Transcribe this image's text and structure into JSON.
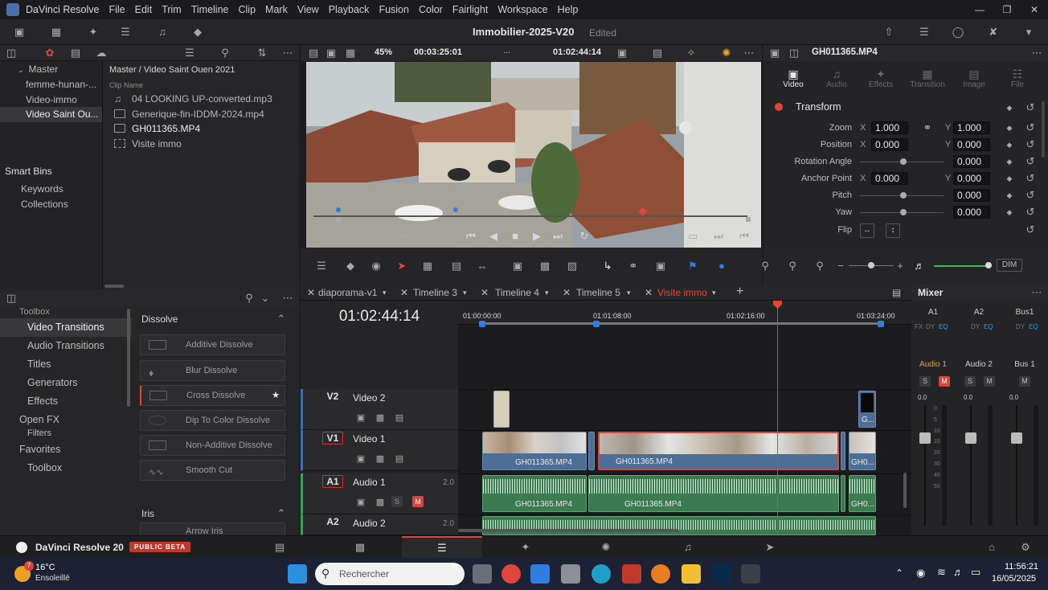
{
  "app": {
    "title": "DaVinci Resolve",
    "menu": [
      "File",
      "Edit",
      "Trim",
      "Timeline",
      "Clip",
      "Mark",
      "View",
      "Playback",
      "Fusion",
      "Color",
      "Fairlight",
      "Workspace",
      "Help"
    ],
    "project_title": "Immobilier-2025-V20",
    "project_status": "Edited"
  },
  "mediapool": {
    "breadcrumb": "Master / Video Saint Ouen 2021",
    "column_header": "Clip Name",
    "bins_root": "Master",
    "bins": [
      "femme-hunan-...",
      "Video-immo",
      "Video Saint Ou..."
    ],
    "smart_bins": "Smart Bins",
    "smart_items": [
      "Keywords",
      "Collections"
    ],
    "clips": [
      "04 LOOKING UP-converted.mp3",
      "Generique-fin-IDDM-2024.mp4",
      "GH011365.MP4",
      "Visite immo"
    ]
  },
  "viewer": {
    "zoom": "45%",
    "duration": "00:03:25:01",
    "more": "...",
    "timecode": "01:02:44:14"
  },
  "inspector": {
    "clip_name": "GH011365.MP4",
    "tabs": [
      "Video",
      "Audio",
      "Effects",
      "Transition",
      "Image",
      "File"
    ],
    "section": "Transform",
    "rows": [
      {
        "label": "Zoom",
        "x_axis": "X",
        "x": "1.000",
        "y_axis": "Y",
        "y": "1.000"
      },
      {
        "label": "Position",
        "x_axis": "X",
        "x": "0.000",
        "y_axis": "Y",
        "y": "0.000"
      },
      {
        "label": "Rotation Angle",
        "x_axis": "",
        "x": "",
        "y_axis": "",
        "y": "0.000"
      },
      {
        "label": "Anchor Point",
        "x_axis": "X",
        "x": "0.000",
        "y_axis": "Y",
        "y": "0.000"
      },
      {
        "label": "Pitch",
        "x_axis": "",
        "x": "",
        "y_axis": "",
        "y": "0.000"
      },
      {
        "label": "Yaw",
        "x_axis": "",
        "x": "",
        "y_axis": "",
        "y": "0.000"
      },
      {
        "label": "Flip",
        "x_axis": "",
        "x": "",
        "y_axis": "",
        "y": ""
      }
    ]
  },
  "effects": {
    "toolbox_label": "Toolbox",
    "categories": [
      "Video Transitions",
      "Audio Transitions",
      "Titles",
      "Generators",
      "Effects",
      "Open FX",
      "Filters"
    ],
    "favorites": "Favorites",
    "favorites_items": [
      "Toolbox"
    ],
    "group": "Dissolve",
    "items": [
      "Additive Dissolve",
      "Blur Dissolve",
      "Cross Dissolve",
      "Dip To Color Dissolve",
      "Non-Additive Dissolve",
      "Smooth Cut"
    ],
    "group2": "Iris",
    "group2_item": "Arrow Iris"
  },
  "timeline": {
    "tabs": [
      "diaporama-v1",
      "Timeline 3",
      "Timeline 4",
      "Timeline 5",
      "Visite immo"
    ],
    "timecode": "01:02:44:14",
    "ruler": [
      "01:00:00:00",
      "01:01:08:00",
      "01:02:16:00",
      "01:03:24:00"
    ],
    "tracks": [
      {
        "id": "V2",
        "name": "Video 2",
        "level": ""
      },
      {
        "id": "V1",
        "name": "Video 1",
        "level": ""
      },
      {
        "id": "A1",
        "name": "Audio 1",
        "level": "2.0"
      },
      {
        "id": "A2",
        "name": "Audio 2",
        "level": "2.0"
      }
    ],
    "clip_name": "GH011365.MP4",
    "clip_short": "GH0...",
    "v2_short": "G..."
  },
  "mixer": {
    "title": "Mixer",
    "channels": [
      "A1",
      "A2",
      "Bus1"
    ],
    "channel_names": [
      "Audio 1",
      "Audio 2",
      "Bus 1"
    ],
    "level_db": "0.0",
    "scale": [
      "0",
      "5",
      "10",
      "15",
      "20",
      "30",
      "40",
      "50"
    ],
    "dim": "DIM"
  },
  "pagebar": {
    "app_label": "DaVinci Resolve 20",
    "badge": "PUBLIC BETA"
  },
  "taskbar": {
    "weather_temp": "16°C",
    "weather_desc": "Ensoleillé",
    "weather_badge": "7",
    "search_placeholder": "Rechercher",
    "time": "11:56:21",
    "date": "16/05/2025"
  },
  "colors": {
    "accent": "#e0463b",
    "video_clip": "#4e6f95",
    "audio_clip": "#3c7a52",
    "playhead": "#e0463b",
    "blue_marker": "#2f7de0"
  }
}
